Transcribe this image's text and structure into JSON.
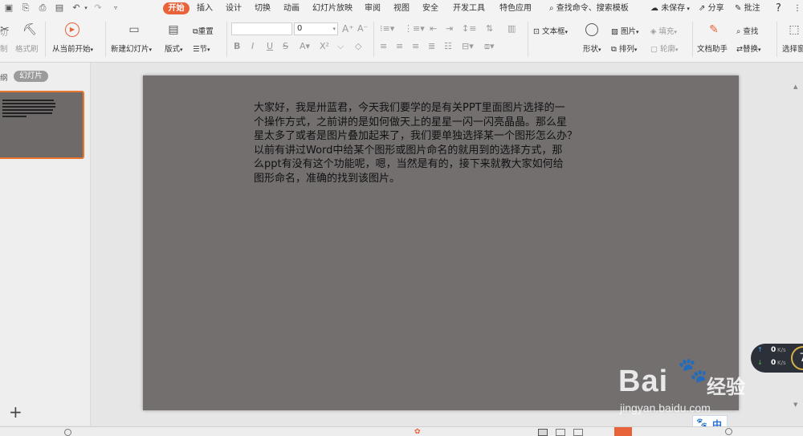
{
  "menu": {
    "tabs": [
      "开始",
      "插入",
      "设计",
      "切换",
      "动画",
      "幻灯片放映",
      "审阅",
      "视图",
      "安全",
      "开发工具",
      "特色应用"
    ],
    "search": "查找命令、搜索模板",
    "unsaved": "未保存",
    "share": "分享",
    "comment": "批注",
    "help": "?"
  },
  "ribbon": {
    "cut": "切",
    "cut2": "制",
    "format_painter": "格式刷",
    "from_current": "从当前开始",
    "new_slide": "新建幻灯片",
    "layout": "版式",
    "reset": "重置",
    "section": "节",
    "font_size": "0",
    "text_box": "文本框",
    "shape": "形状",
    "picture": "图片",
    "fill": "填充",
    "arrange": "排列",
    "outline": "轮廓",
    "doc_helper": "文档助手",
    "find": "查找",
    "replace": "替换",
    "select_pane": "选择窗"
  },
  "left": {
    "outline_tab": "纲",
    "slides_tab": "幻灯片",
    "add": "+"
  },
  "slide": {
    "lines": [
      "大家好，我是卅蓝君，今天我们要学的是有关PPT里面图片选择的一",
      "个操作方式，之前讲的是如何做天上的星星一闪一闪亮晶晶。那么星",
      "星太多了或者是图片叠加起来了，我们要单独选择某一个图形怎么办？",
      "以前有讲过Word中给某个图形或图片命名的就用到的选择方式，那",
      "么ppt有没有这个功能呢，嗯，当然是有的，接下来就教大家如何给",
      "图形命名，准确的找到该图片。"
    ]
  },
  "network": {
    "up": "0",
    "down": "0",
    "unit": "K/s",
    "badge": "7"
  },
  "watermark": {
    "brand": "Bai",
    "brand2": "经验",
    "url": "jingyan.baidu.com"
  },
  "ime": {
    "label": "中"
  },
  "colors": {
    "accent": "#e8623a",
    "slide_bg": "#736f6f",
    "thumb_border": "#e8762e"
  }
}
